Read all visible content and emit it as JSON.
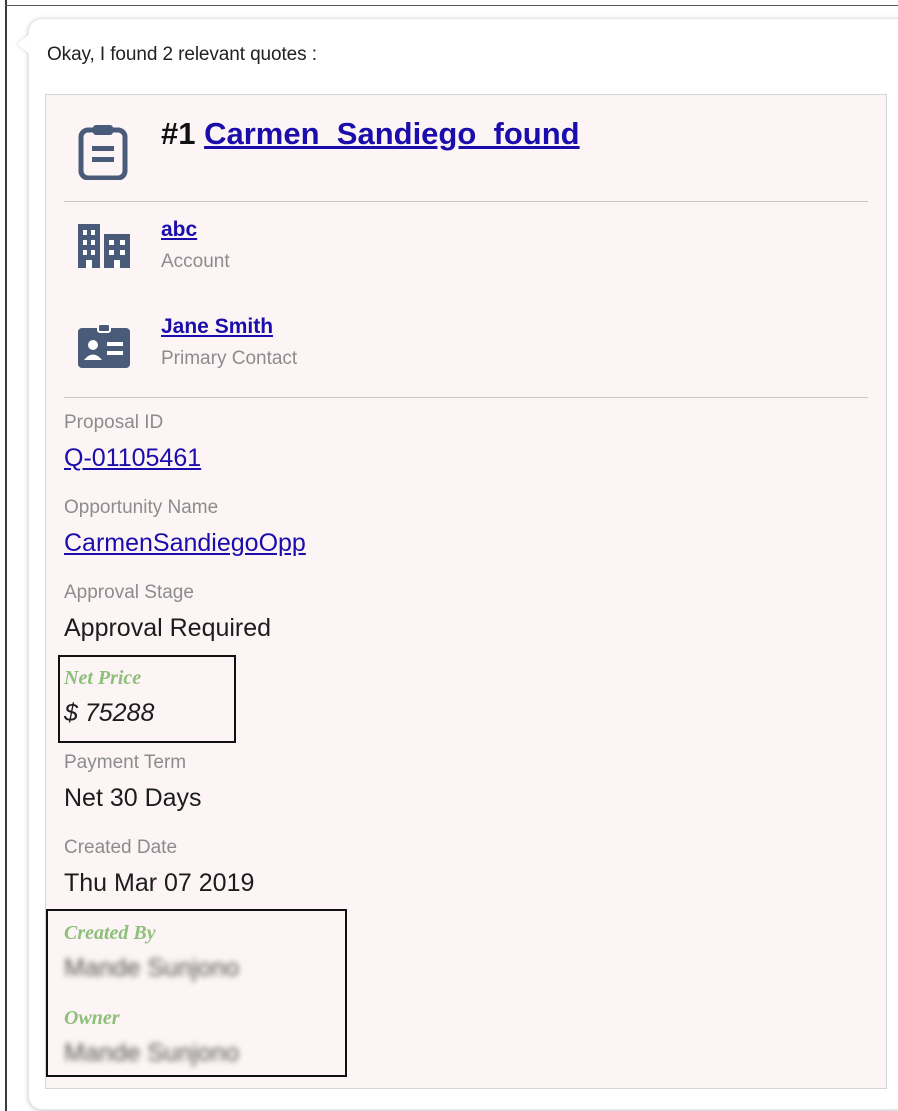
{
  "intro": "Okay, I found 2 relevant quotes :",
  "quote": {
    "number": "#1",
    "name": "Carmen_Sandiego_found",
    "account": {
      "name": "abc",
      "label": "Account"
    },
    "contact": {
      "name": "Jane Smith",
      "label": "Primary Contact"
    },
    "fields": {
      "proposal_id": {
        "label": "Proposal ID",
        "value": "Q-01105461"
      },
      "opportunity": {
        "label": "Opportunity Name",
        "value": "CarmenSandiegoOpp"
      },
      "approval_stage": {
        "label": "Approval Stage",
        "value": "Approval Required"
      },
      "net_price": {
        "label": "Net Price",
        "value": "$ 75288"
      },
      "payment_term": {
        "label": "Payment Term",
        "value": "Net 30 Days"
      },
      "created_date": {
        "label": "Created Date",
        "value": "Thu Mar 07 2019"
      },
      "created_by": {
        "label": "Created By",
        "value": "Mande Sunjono"
      },
      "owner": {
        "label": "Owner",
        "value": "Mande Sunjono"
      }
    }
  },
  "icons": {
    "header": "clipboard-icon",
    "account": "building-icon",
    "contact": "contact-card-icon"
  },
  "colors": {
    "link": "#1a0dab",
    "card_bg": "#fdf5f5",
    "icon": "#4a5b7a",
    "highlight_label": "#8dc07a"
  }
}
